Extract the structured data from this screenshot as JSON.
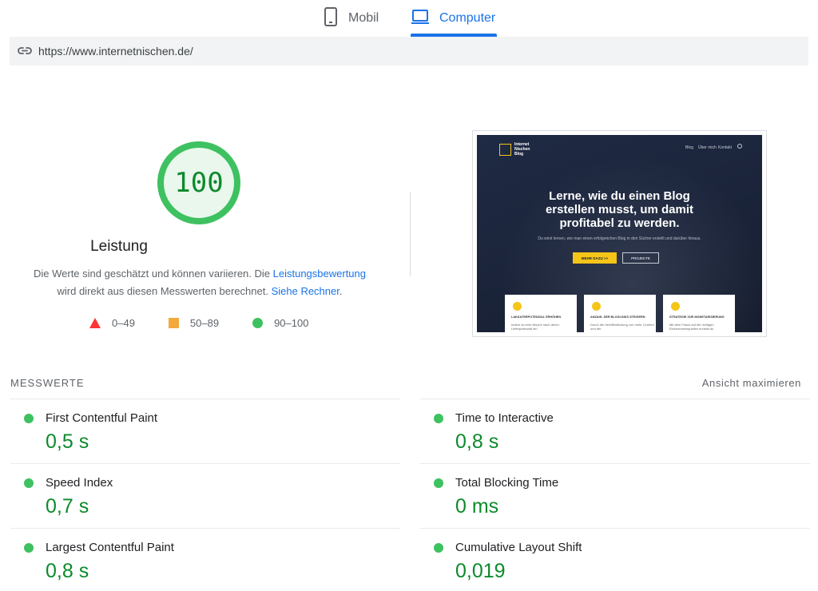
{
  "tabs": {
    "mobile_label": "Mobil",
    "desktop_label": "Computer",
    "active": "Computer"
  },
  "url": "https://www.internetnischen.de/",
  "score": {
    "value": "100",
    "title": "Leistung",
    "description_part1": "Die Werte sind geschätzt und können variieren. Die ",
    "description_link1": "Leistungsbewertung",
    "description_part2": " wird direkt aus diesen Messwerten berechnet. ",
    "description_link2": "Siehe Rechner",
    "description_part3": ".",
    "gauge_fraction": 1.0,
    "color": "#0d8a2c",
    "ring_color": "#3ec160"
  },
  "legend": {
    "fail": "0–49",
    "average": "50–89",
    "pass": "90–100"
  },
  "screenshot": {
    "logo_lines": [
      "Internet",
      "Nischen",
      "Blog"
    ],
    "nav": [
      "Blog",
      "Über mich",
      "Kontakt"
    ],
    "headline_lines": [
      "Lerne, wie du einen Blog",
      "erstellen musst, um damit",
      "profitabel zu werden."
    ],
    "subline": "Du wirst lernen, wie man einen erfolgreichen Blog in den Sücher erstellt und darüber hinaus.",
    "primary_button": "MEHR DAZU >>",
    "secondary_button": "PROJEKTE",
    "cards": [
      {
        "title": "LAKKATERPOTENZIAL ERHÖHEN",
        "text": "Indem du eine Nische nach deren Lieferpotenzial hin"
      },
      {
        "title": "ANZAHL DER BLOGLINKS STEIGERN",
        "text": "Durch die Veröffentlichung von mehr Content und der"
      },
      {
        "title": "STRATEGIE ZUR MONETARISIERUNG",
        "text": "Mit dem Fokus auf die richtigen Einkommensquellen erzielst du"
      }
    ]
  },
  "metrics": {
    "header": "MESSWERTE",
    "toggle": "Ansicht maximieren",
    "left": [
      {
        "name": "First Contentful Paint",
        "value": "0,5 s"
      },
      {
        "name": "Speed Index",
        "value": "0,7 s"
      },
      {
        "name": "Largest Contentful Paint",
        "value": "0,8 s"
      }
    ],
    "right": [
      {
        "name": "Time to Interactive",
        "value": "0,8 s"
      },
      {
        "name": "Total Blocking Time",
        "value": "0 ms"
      },
      {
        "name": "Cumulative Layout Shift",
        "value": "0,019"
      }
    ]
  }
}
